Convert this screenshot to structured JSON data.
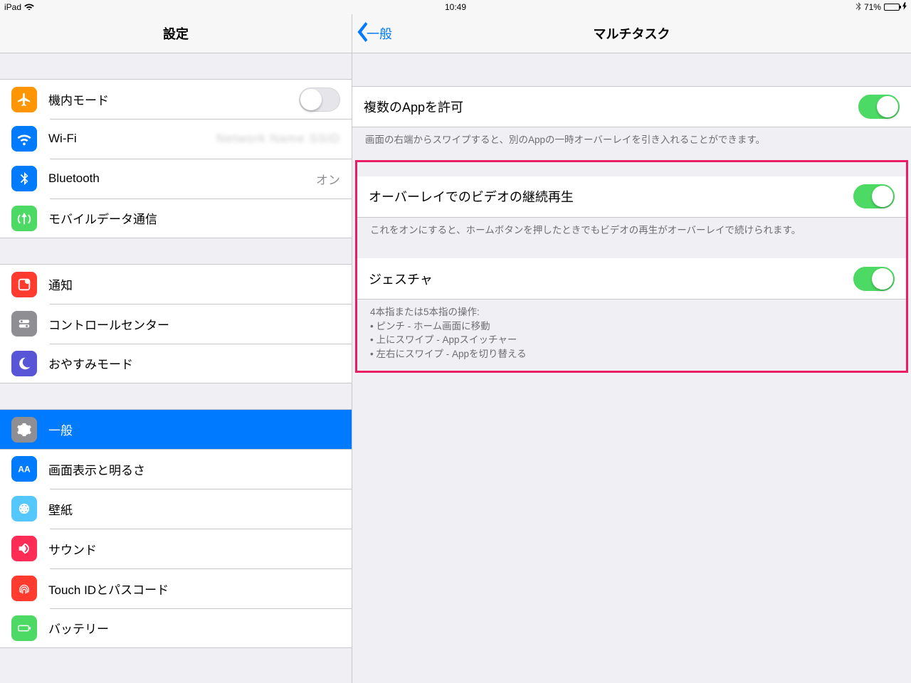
{
  "status": {
    "device": "iPad",
    "time": "10:49",
    "battery_pct": "71%",
    "battery_level": 71
  },
  "left": {
    "title": "設定",
    "group_radio": {
      "airplane": {
        "label": "機内モード",
        "on": false
      },
      "wifi": {
        "label": "Wi-Fi",
        "value": "████████"
      },
      "bluetooth": {
        "label": "Bluetooth",
        "value": "オン"
      },
      "cellular": {
        "label": "モバイルデータ通信"
      }
    },
    "group_notify": {
      "notifications": {
        "label": "通知"
      },
      "control_center": {
        "label": "コントロールセンター"
      },
      "dnd": {
        "label": "おやすみモード"
      }
    },
    "group_general": {
      "general": {
        "label": "一般"
      },
      "display": {
        "label": "画面表示と明るさ"
      },
      "wallpaper": {
        "label": "壁紙"
      },
      "sounds": {
        "label": "サウンド"
      },
      "touchid": {
        "label": "Touch IDとパスコード"
      },
      "battery": {
        "label": "バッテリー"
      }
    }
  },
  "right": {
    "back": "一般",
    "title": "マルチタスク",
    "allow_multiple": {
      "label": "複数のAppを許可",
      "on": true,
      "footer": "画面の右端からスワイプすると、別のAppの一時オーバーレイを引き入れることができます。"
    },
    "pip": {
      "label": "オーバーレイでのビデオの継続再生",
      "on": true,
      "footer": "これをオンにすると、ホームボタンを押したときでもビデオの再生がオーバーレイで続けられます。"
    },
    "gestures": {
      "label": "ジェスチャ",
      "on": true,
      "footer_head": "4本指または5本指の操作:",
      "footer_b1": "ピンチ - ホーム画面に移動",
      "footer_b2": "上にスワイプ - Appスイッチャー",
      "footer_b3": "左右にスワイプ - Appを切り替える"
    }
  },
  "colors": {
    "airplane": "#ff9500",
    "wifi": "#007aff",
    "bluetooth": "#007aff",
    "cellular": "#4cd964",
    "notifications": "#ff3b30",
    "control_center": "#8e8e93",
    "dnd": "#5856d6",
    "general": "#8e8e93",
    "general_sel": "#6d6d6d",
    "display": "#007aff",
    "wallpaper": "#54c7fc",
    "sounds": "#ff3b30",
    "touchid": "#ff3b30",
    "battery": "#4cd964"
  }
}
